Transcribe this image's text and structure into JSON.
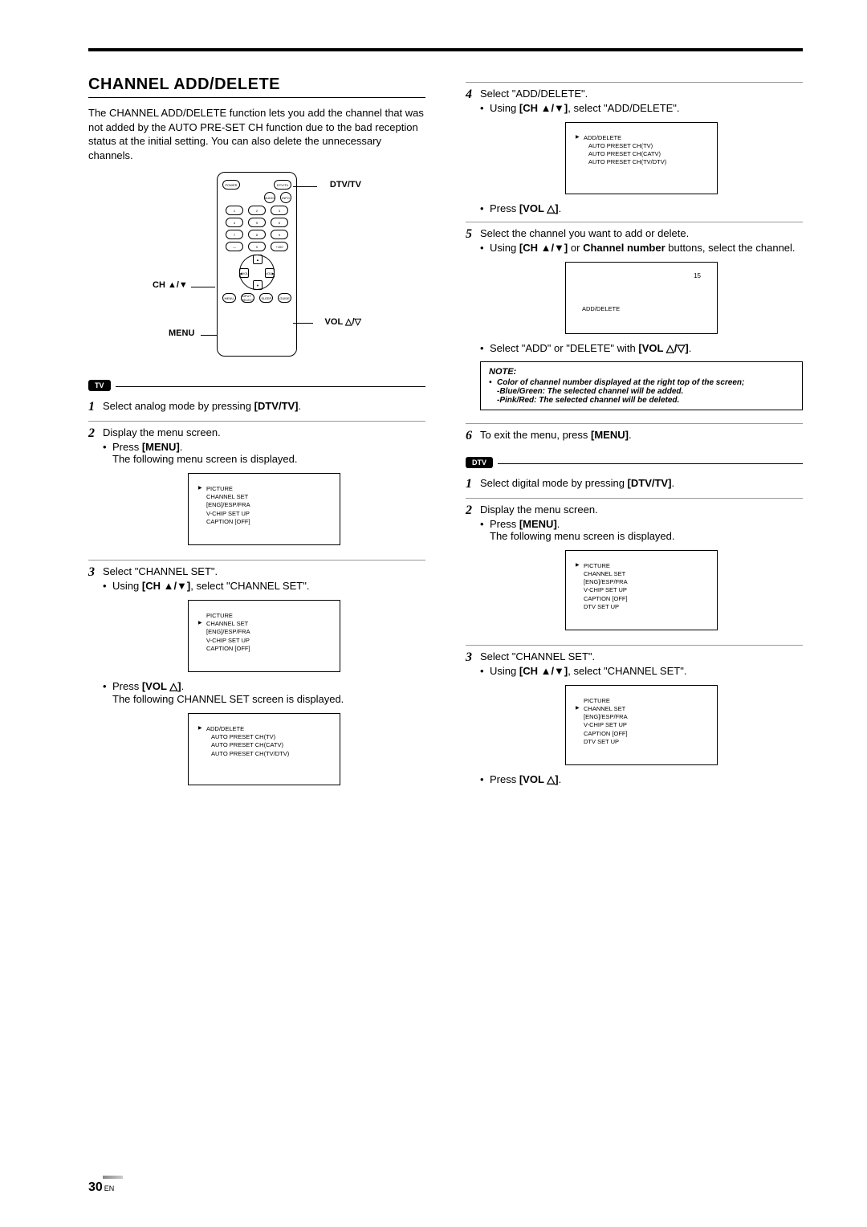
{
  "title": "CHANNEL ADD/DELETE",
  "intro": "The CHANNEL ADD/DELETE function lets you add the channel that was not added by the AUTO PRE-SET CH function due to the bad reception status at the initial setting. You can also delete the unnecessary channels.",
  "remote_labels": {
    "dtv_tv": "DTV/TV",
    "ch": "CH ▲/▼",
    "vol": "VOL △/▽",
    "menu": "MENU"
  },
  "remote_micro": {
    "power": "POWER",
    "dtvtv": "DTV/TV",
    "audio": "AUDIO",
    "info": "INFO",
    "b1": "1",
    "b2": "2",
    "b3": "3",
    "b4": "4",
    "b5": "5",
    "b6": "6",
    "b7": "7",
    "b8": "8",
    "b9": "9",
    "bdash": "—",
    "b0": "0",
    "b100": "+100",
    "shift": "SHIFT",
    "channel": "CHANNEL",
    "ch_up": "▲",
    "ch_down": "▼",
    "vol_l": "◀VOL",
    "vol_r": "VOL▶",
    "ch_txt": "CH",
    "menu": "MENU",
    "input": "INPUT\nSELECT",
    "sleep": "SLEEP",
    "guide": "GUIDE"
  },
  "tags": {
    "tv": "TV",
    "dtv": "DTV"
  },
  "left": {
    "step1": "Select analog mode by pressing ",
    "step1_b": "[DTV/TV]",
    "step1_end": ".",
    "step2": "Display the menu screen.",
    "step2_sub1a": "Press ",
    "step2_sub1b": "[MENU]",
    "step2_sub1c": ".",
    "step2_sub2": "The following menu screen is displayed.",
    "screen1": {
      "l1": "PICTURE",
      "l2": "CHANNEL SET",
      "l3": "[ENG]/ESP/FRA",
      "l4": "V-CHIP SET UP",
      "l5": "CAPTION [OFF]"
    },
    "step3": "Select \"CHANNEL SET\".",
    "step3_sub_a": "Using ",
    "step3_sub_b": "[CH ▲/▼]",
    "step3_sub_c": ", select \"CHANNEL SET\".",
    "screen2": {
      "l1": "PICTURE",
      "l2": "CHANNEL SET",
      "l3": "[ENG]/ESP/FRA",
      "l4": "V-CHIP SET UP",
      "l5": "CAPTION [OFF]"
    },
    "step3b_a": "Press ",
    "step3b_b": "[VOL △]",
    "step3b_c": ".",
    "step3c": "The following CHANNEL SET screen is displayed.",
    "screen3": {
      "l1": "ADD/DELETE",
      "l2": "AUTO PRESET CH(TV)",
      "l3": "AUTO PRESET CH(CATV)",
      "l4": "AUTO PRESET CH(TV/DTV)"
    }
  },
  "right": {
    "step4": "Select \"ADD/DELETE\".",
    "step4_sub_a": "Using ",
    "step4_sub_b": "[CH ▲/▼]",
    "step4_sub_c": ", select \"ADD/DELETE\".",
    "screen4": {
      "l1": "ADD/DELETE",
      "l2": "AUTO PRESET CH(TV)",
      "l3": "AUTO PRESET CH(CATV)",
      "l4": "AUTO PRESET CH(TV/DTV)"
    },
    "step4b_a": "Press ",
    "step4b_b": "[VOL △]",
    "step4b_c": ".",
    "step5": "Select the channel you want to add or delete.",
    "step5_sub_a": "Using ",
    "step5_sub_b": "[CH ▲/▼]",
    "step5_sub_c": " or ",
    "step5_sub_d": "Channel number",
    "step5_sub_e": " buttons, select the channel.",
    "screen5": {
      "ch": "15",
      "label": "ADD/DELETE"
    },
    "step5b_a": "Select \"ADD\" or \"DELETE\" with ",
    "step5b_b": "[VOL △/▽]",
    "step5b_c": ".",
    "note": {
      "title": "NOTE:",
      "n1": "Color of channel number displayed at the right top of the screen;",
      "n2": "-Blue/Green: The selected channel will be added.",
      "n3": "-Pink/Red: The selected channel will be deleted."
    },
    "step6_a": "To exit the menu, press ",
    "step6_b": "[MENU]",
    "step6_c": ".",
    "dstep1_a": "Select digital mode by pressing ",
    "dstep1_b": "[DTV/TV]",
    "dstep1_c": ".",
    "dstep2": "Display the menu screen.",
    "dstep2_sub1a": "Press ",
    "dstep2_sub1b": "[MENU]",
    "dstep2_sub1c": ".",
    "dstep2_sub2": "The following menu screen is displayed.",
    "screen6": {
      "l1": "PICTURE",
      "l2": "CHANNEL SET",
      "l3": "[ENG]/ESP/FRA",
      "l4": "V-CHIP SET UP",
      "l5": "CAPTION [OFF]",
      "l6": "DTV SET UP"
    },
    "dstep3": "Select \"CHANNEL SET\".",
    "dstep3_sub_a": "Using ",
    "dstep3_sub_b": "[CH ▲/▼]",
    "dstep3_sub_c": ", select \"CHANNEL SET\".",
    "screen7": {
      "l1": "PICTURE",
      "l2": "CHANNEL SET",
      "l3": "[ENG]/ESP/FRA",
      "l4": "V-CHIP SET UP",
      "l5": "CAPTION [OFF]",
      "l6": "DTV SET UP"
    },
    "dstep3b_a": "Press ",
    "dstep3b_b": "[VOL △]",
    "dstep3b_c": "."
  },
  "page_number": "30",
  "page_lang": "EN"
}
